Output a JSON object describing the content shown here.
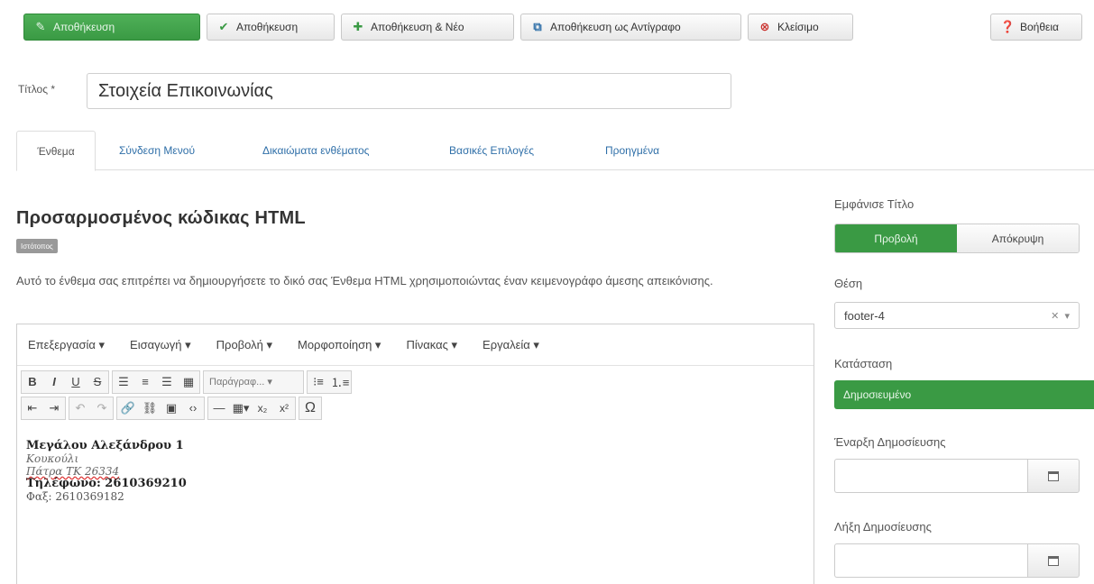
{
  "toolbar": {
    "save": "Αποθήκευση",
    "save_close": "Αποθήκευση",
    "save_new": "Αποθήκευση & Νέο",
    "save_copy": "Αποθήκευση ως Αντίγραφο",
    "close": "Κλείσιμο",
    "help": "Βοήθεια"
  },
  "title_field": {
    "label": "Τίτλος *",
    "value": "Στοιχεία Επικοινωνίας"
  },
  "tabs": [
    "Ένθεμα",
    "Σύνδεση Μενού",
    "Δικαιώματα ενθέματος",
    "Βασικές Επιλογές",
    "Προηγμένα"
  ],
  "module": {
    "title": "Προσαρμοσμένος κώδικας HTML",
    "badge": "Ιστότοπος",
    "description": "Αυτό το ένθεμα σας επιτρέπει να δημιουργήσετε το δικό σας Ένθεμα HTML χρησιμοποιώντας έναν κειμενογράφο άμεσης απεικόνισης."
  },
  "editor": {
    "menus": [
      "Επεξεργασία ▾",
      "Εισαγωγή ▾",
      "Προβολή ▾",
      "Μορφοποίηση ▾",
      "Πίνακας ▾",
      "Εργαλεία ▾"
    ],
    "format_select": "Παράγραφ... ▾",
    "content": {
      "line1": "Μεγάλου Αλεξάνδρου 1",
      "line2": "Κουκούλι",
      "line3": "Πάτρα ΤΚ 26334",
      "line4": "Τηλέφωνο: 2610369210",
      "line5": "Φαξ: 2610369182"
    }
  },
  "sidebar": {
    "show_title_label": "Εμφάνισε Τίτλο",
    "show": "Προβολή",
    "hide": "Απόκρυψη",
    "position_label": "Θέση",
    "position_value": "footer-4",
    "status_label": "Κατάσταση",
    "status_value": "Δημοσιευμένο",
    "publish_up_label": "Έναρξη Δημοσίευσης",
    "publish_down_label": "Λήξη Δημοσίευσης"
  },
  "colors": {
    "primary_green": "#3a9a44",
    "link_blue": "#2f6fa8"
  }
}
